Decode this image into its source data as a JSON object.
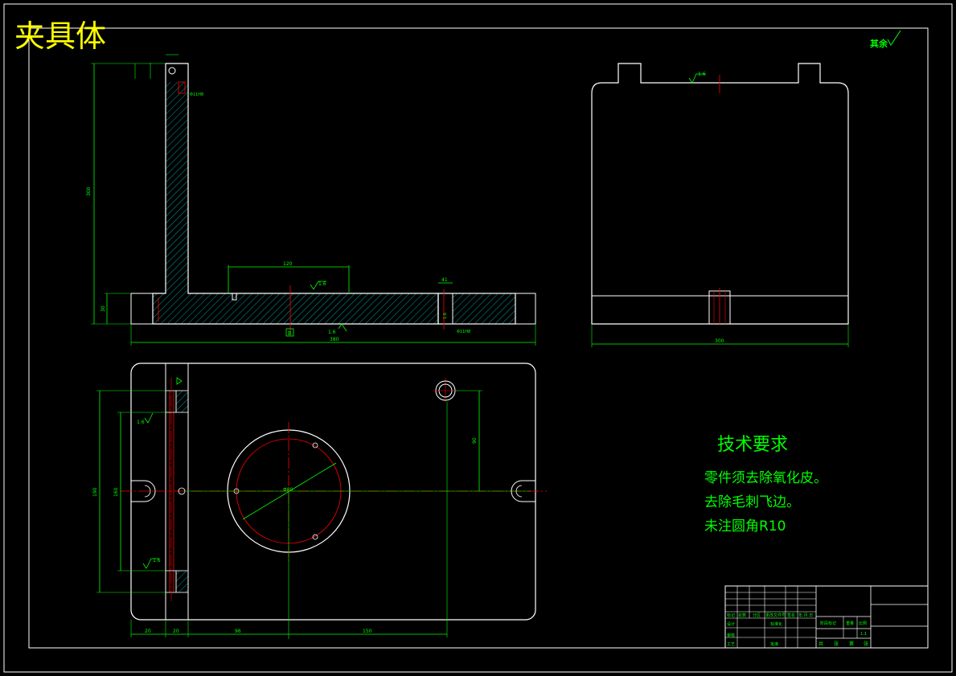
{
  "drawing_title": "夹具体",
  "roughness_note": "其余",
  "roughness_values": {
    "main_face": "1.6",
    "bottom_face": "1.6",
    "side_view_top": "1.6",
    "plan_left_upper": "1.6",
    "plan_left_lower": "1.6",
    "boss_hole": "1.6",
    "slot_bottom": "1.6"
  },
  "dimensions": {
    "front_height": "300",
    "front_width": "380",
    "front_base_height": "30",
    "front_pad_width": "120",
    "front_slot": "41",
    "side_width": "300",
    "plan_height": "190",
    "plan_inner_height": "160",
    "plan_right_offset": "90",
    "plan_bottom_a": "20",
    "plan_bottom_b": "20",
    "plan_bottom_c": "96",
    "plan_bottom_d": "150",
    "circle_dia": "Φ80",
    "hole_tol": "Φ11H8"
  },
  "datum_label": "B",
  "tech_requirements": {
    "heading": "技术要求",
    "items": [
      "零件须去除氧化皮。",
      "去除毛刺飞边。",
      "未注圆角R10"
    ]
  },
  "title_block": {
    "cells": [
      "标记",
      "处数",
      "分区",
      "更改文件号",
      "签名",
      "年.月.日",
      "设计",
      "标准化",
      "审核",
      "工艺",
      "批准",
      "阶段标记",
      "重量",
      "比例",
      "1:1",
      "共",
      "张",
      "第",
      "张"
    ]
  },
  "colors": {
    "background": "#000000",
    "line": "#ffffff",
    "dimension": "#00ff00",
    "center": "#ff0000",
    "hatch": "#00c8c8",
    "title": "#ffff00",
    "note": "#00ff00"
  }
}
